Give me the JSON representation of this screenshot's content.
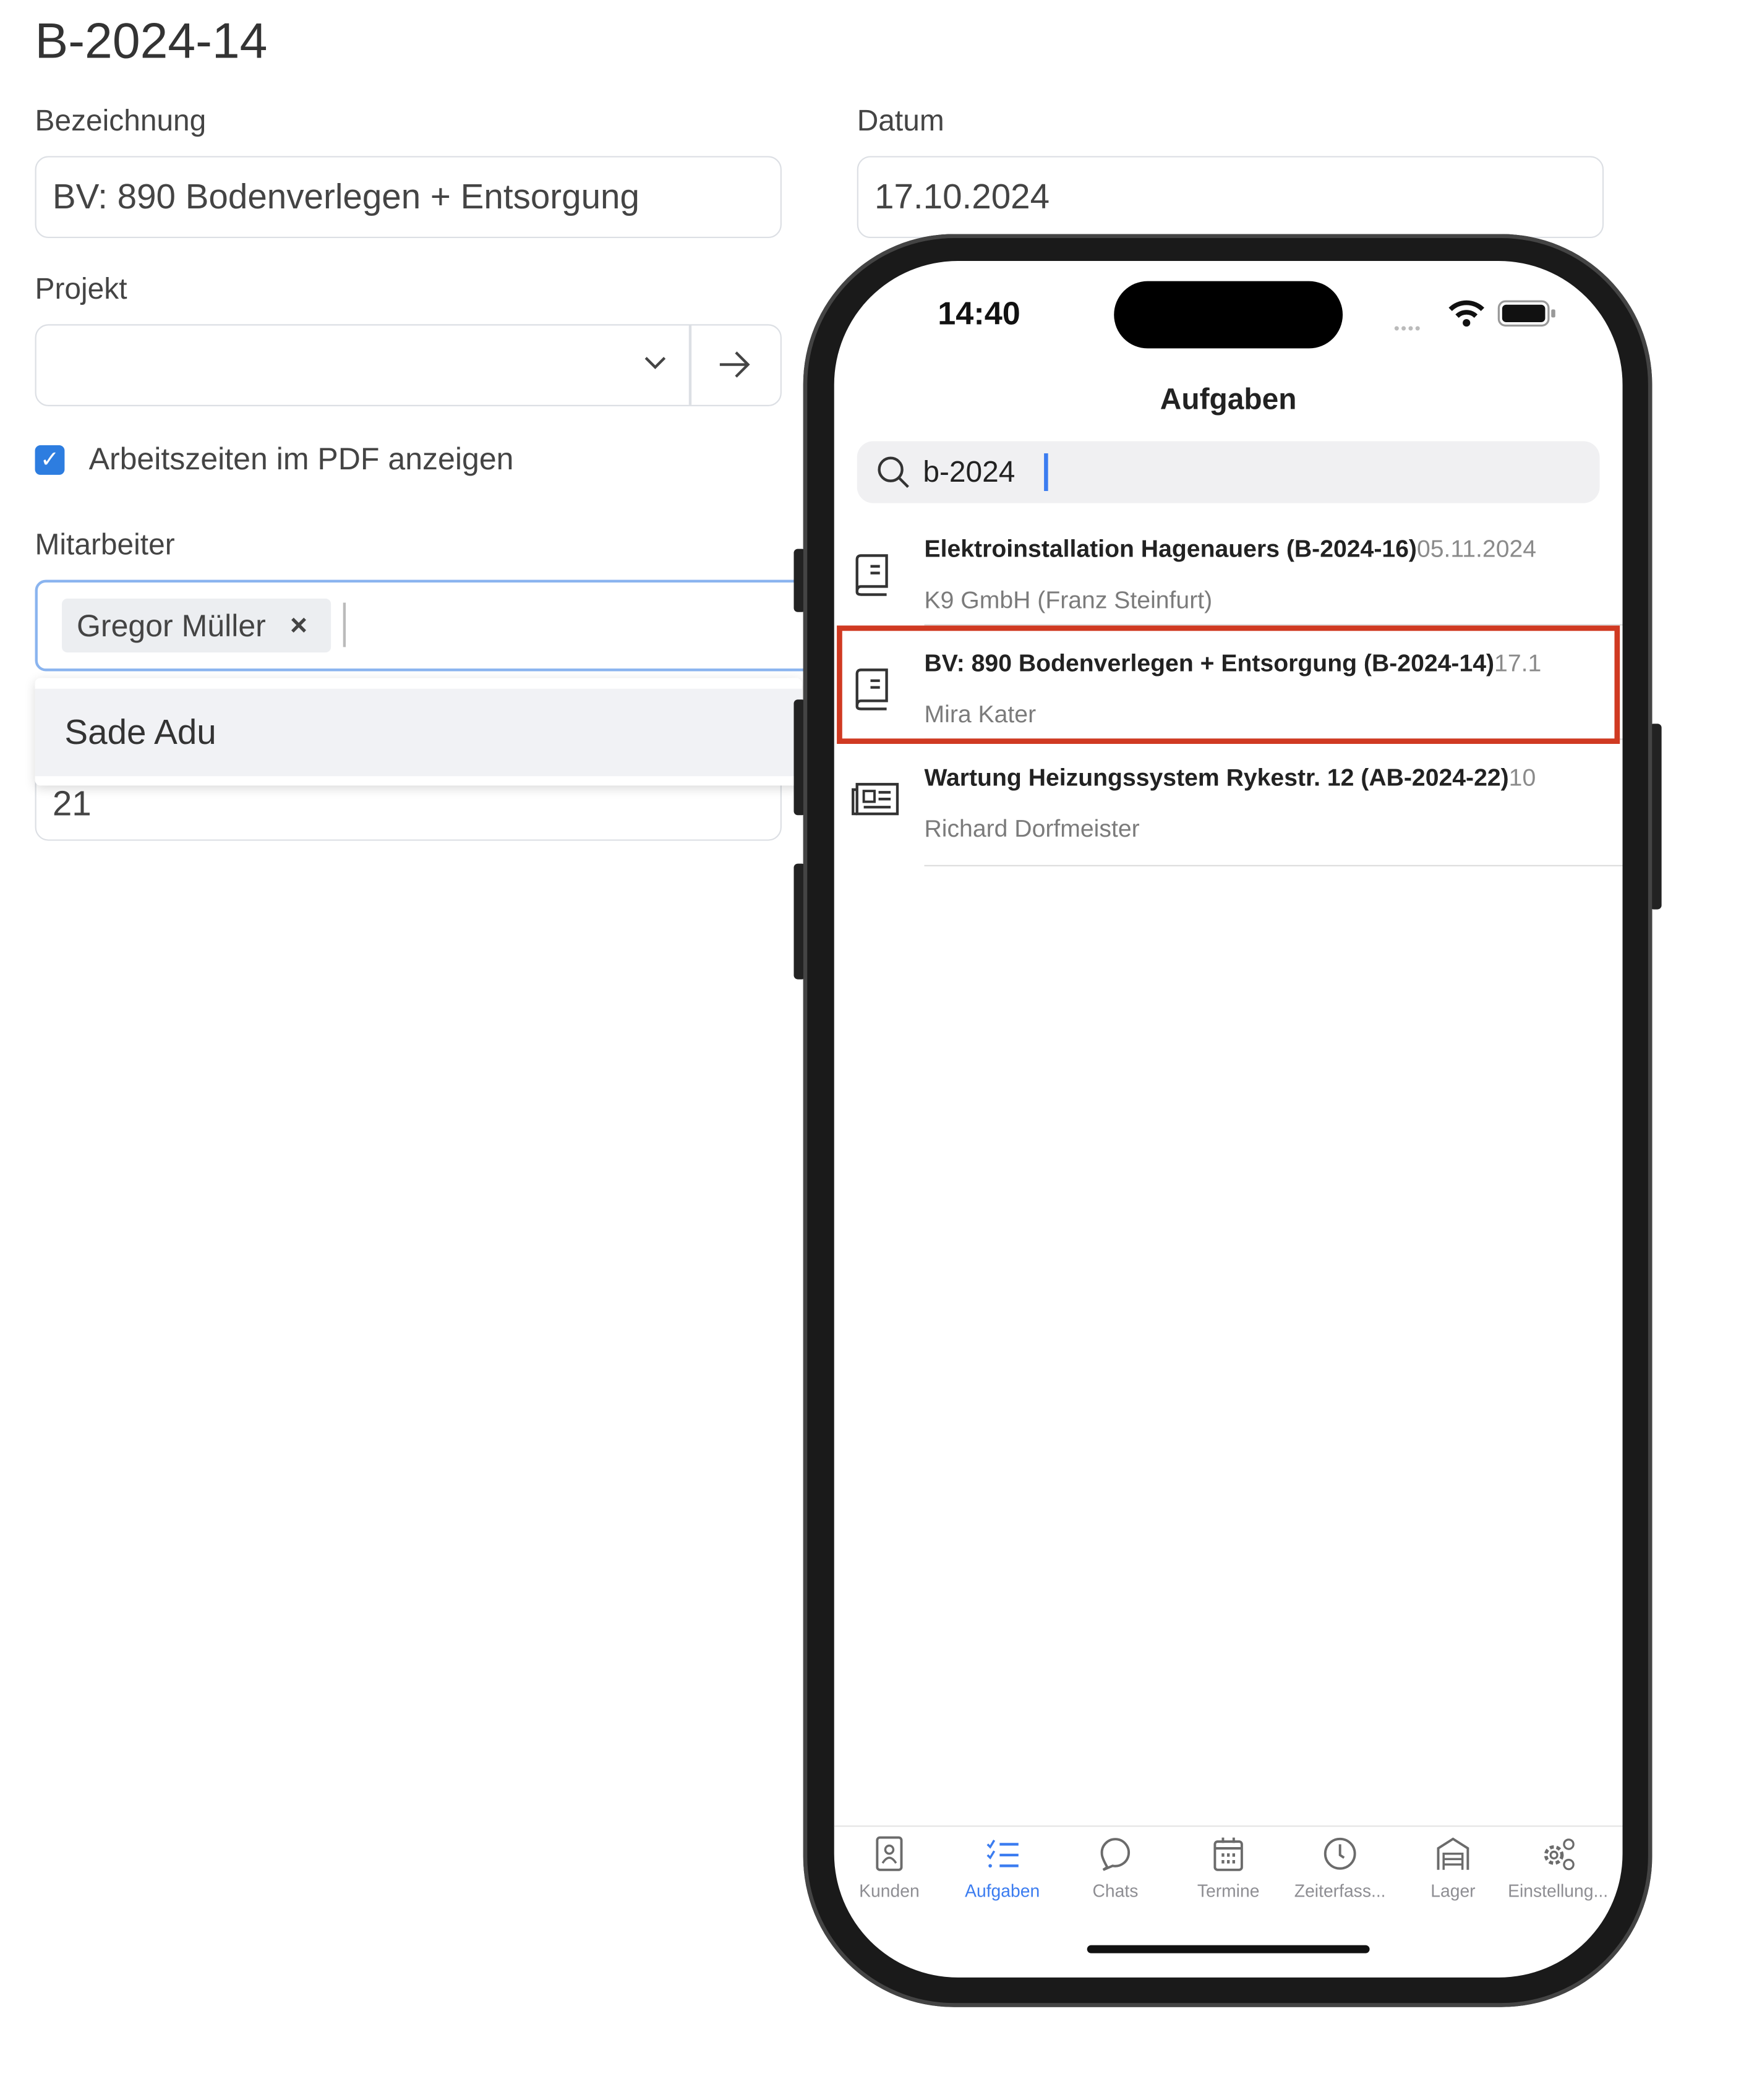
{
  "form": {
    "title": "B-2024-14",
    "bezeichnung_label": "Bezeichnung",
    "bezeichnung_value": "BV: 890 Bodenverlegen + Entsorgung",
    "datum_label": "Datum",
    "datum_value": "17.10.2024",
    "projekt_label": "Projekt",
    "projekt_value": "",
    "checkbox_label": "Arbeitszeiten im PDF anzeigen",
    "checkbox_checked": true,
    "mitarbeiter_label": "Mitarbeiter",
    "mitarbeiter_chip": "Gregor Müller",
    "chip_remove": "×",
    "dropdown_option": "Sade Adu",
    "hidden_field_value": "21"
  },
  "phone": {
    "time": "14:40",
    "nav_title": "Aufgaben",
    "search_value": "b-2024",
    "results": [
      {
        "title": "Elektroinstallation Hagenauers (B-2024-16)",
        "date": "05.11.2024",
        "subtitle": "K9 GmbH (Franz Steinfurt)",
        "icon": "book-icon",
        "highlighted": false
      },
      {
        "title": "BV: 890 Bodenverlegen + Entsorgung (B-2024-14)",
        "date": "17.1",
        "subtitle": "Mira Kater",
        "icon": "book-icon",
        "highlighted": true
      },
      {
        "title": "Wartung Heizungssystem Rykestr. 12 (AB-2024-22)",
        "date": "10",
        "subtitle": "Richard Dorfmeister",
        "icon": "newspaper-icon",
        "highlighted": false
      }
    ],
    "tabs": [
      {
        "label": "Kunden",
        "icon": "contact-book-icon"
      },
      {
        "label": "Aufgaben",
        "icon": "checklist-icon",
        "active": true
      },
      {
        "label": "Chats",
        "icon": "chat-bubble-icon"
      },
      {
        "label": "Termine",
        "icon": "calendar-icon"
      },
      {
        "label": "Zeiterfass...",
        "icon": "clock-icon"
      },
      {
        "label": "Lager",
        "icon": "warehouse-icon"
      },
      {
        "label": "Einstellung...",
        "icon": "gears-icon"
      }
    ]
  },
  "colors": {
    "accent": "#2d7de0",
    "tab_active": "#3b7cf0",
    "highlight_border": "#d03a22"
  }
}
